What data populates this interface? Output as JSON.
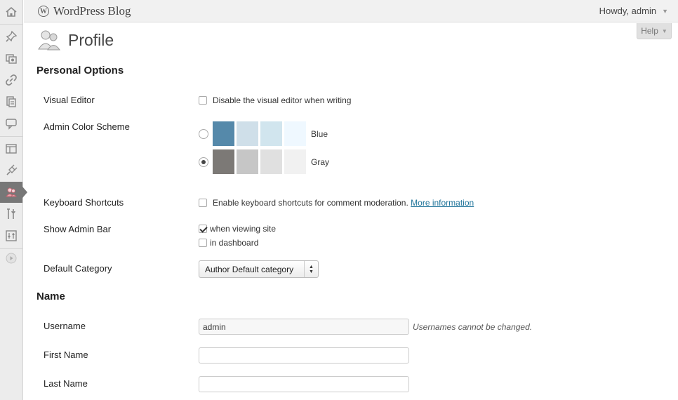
{
  "header": {
    "site_title": "WordPress Blog",
    "greeting": "Howdy, admin"
  },
  "help_tab": {
    "label": "Help"
  },
  "page": {
    "title": "Profile"
  },
  "sidebar": {
    "items": [
      {
        "icon": "dashboard-icon"
      },
      {
        "icon": "pin-icon"
      },
      {
        "icon": "media-icon"
      },
      {
        "icon": "links-icon"
      },
      {
        "icon": "pages-icon"
      },
      {
        "icon": "comments-icon"
      },
      {
        "icon": "appearance-icon"
      },
      {
        "icon": "plugins-icon"
      },
      {
        "icon": "users-icon",
        "active": true
      },
      {
        "icon": "tools-icon"
      },
      {
        "icon": "settings-icon"
      },
      {
        "icon": "collapse-icon"
      }
    ]
  },
  "personal_options": {
    "section_title": "Personal Options",
    "visual_editor": {
      "label": "Visual Editor",
      "checkbox_text": "Disable the visual editor when writing",
      "checked": false
    },
    "color_scheme": {
      "label": "Admin Color Scheme",
      "options": [
        {
          "name": "Blue",
          "selected": false,
          "colors": [
            "#5589aa",
            "#cfdfe9",
            "#d1e5ee",
            "#eff8ff"
          ]
        },
        {
          "name": "Gray",
          "selected": true,
          "colors": [
            "#7c7976",
            "#c6c6c6",
            "#e0e0e0",
            "#f1f1f1"
          ]
        }
      ]
    },
    "keyboard_shortcuts": {
      "label": "Keyboard Shortcuts",
      "checkbox_text": "Enable keyboard shortcuts for comment moderation.",
      "link_text": "More information",
      "checked": false
    },
    "admin_bar": {
      "label": "Show Admin Bar",
      "options": [
        {
          "text": "when viewing site",
          "checked": true
        },
        {
          "text": "in dashboard",
          "checked": false
        }
      ]
    },
    "default_category": {
      "label": "Default Category",
      "selected": "Author Default category"
    }
  },
  "name_section": {
    "section_title": "Name",
    "username": {
      "label": "Username",
      "value": "admin",
      "hint": "Usernames cannot be changed."
    },
    "first_name": {
      "label": "First Name",
      "value": ""
    },
    "last_name": {
      "label": "Last Name",
      "value": ""
    }
  }
}
